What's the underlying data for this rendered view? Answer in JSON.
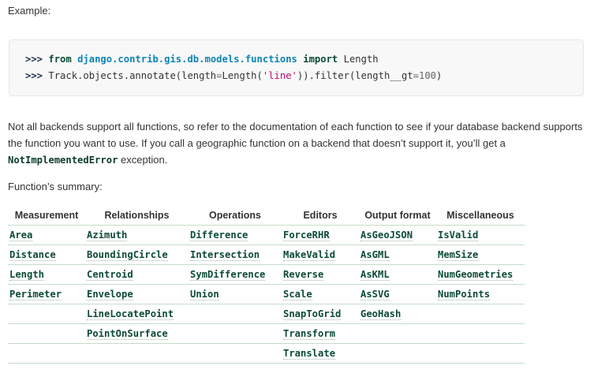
{
  "example_label": "Example:",
  "code": {
    "prompt": ">>>",
    "line1": {
      "kw_from": "from",
      "module": "django.contrib.gis.db.models.functions",
      "kw_import": "import",
      "name": "Length"
    },
    "line2": {
      "pre": "Track.objects.annotate(length",
      "eq1": "=",
      "call": "Length(",
      "str": "'line'",
      "mid": ")).filter(length__gt",
      "eq2": "=",
      "num": "100",
      "end": ")"
    }
  },
  "paragraph": {
    "text_before": "Not all backends support all functions, so refer to the documentation of each function to see if your database backend supports the function you want to use. If you call a geographic function on a backend that doesn’t support it, you’ll get a ",
    "code": "NotImplementedError",
    "text_after": " exception."
  },
  "summary_label": "Function’s summary:",
  "table": {
    "headers": [
      "Measurement",
      "Relationships",
      "Operations",
      "Editors",
      "Output format",
      "Miscellaneous"
    ],
    "rows": [
      [
        "Area",
        "Azimuth",
        "Difference",
        "ForceRHR",
        "AsGeoJSON",
        "IsValid"
      ],
      [
        "Distance",
        "BoundingCircle",
        "Intersection",
        "MakeValid",
        "AsGML",
        "MemSize"
      ],
      [
        "Length",
        "Centroid",
        "SymDifference",
        "Reverse",
        "AsKML",
        "NumGeometries"
      ],
      [
        "Perimeter",
        "Envelope",
        "Union",
        "Scale",
        "AsSVG",
        "NumPoints"
      ],
      [
        "",
        "LineLocatePoint",
        "",
        "SnapToGrid",
        "GeoHash",
        ""
      ],
      [
        "",
        "PointOnSurface",
        "",
        "Transform",
        "",
        ""
      ],
      [
        "",
        "",
        "",
        "Translate",
        "",
        ""
      ]
    ]
  }
}
